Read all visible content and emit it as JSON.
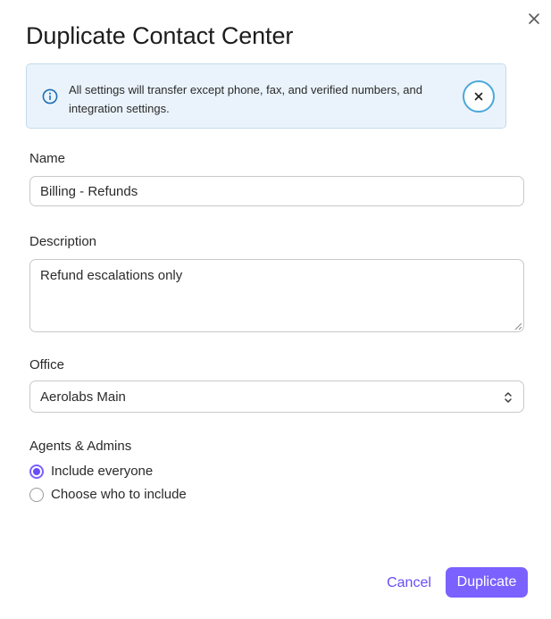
{
  "dialog": {
    "title": "Duplicate Contact Center",
    "close_icon": "close-icon"
  },
  "banner": {
    "icon": "info-icon",
    "text": "All settings will transfer except phone, fax, and verified numbers, and integration settings.",
    "dismiss_icon": "close-icon",
    "accent_color": "#4aa8da",
    "background_color": "#eaf3fb"
  },
  "form": {
    "name": {
      "label": "Name",
      "value": "Billing - Refunds"
    },
    "description": {
      "label": "Description",
      "value": "Refund escalations only"
    },
    "office": {
      "label": "Office",
      "selected": "Aerolabs Main",
      "icon": "chevron-up-down-icon"
    },
    "agents": {
      "label": "Agents & Admins",
      "options": [
        {
          "label": "Include everyone",
          "checked": true
        },
        {
          "label": "Choose who to include",
          "checked": false
        }
      ]
    }
  },
  "footer": {
    "cancel_label": "Cancel",
    "duplicate_label": "Duplicate",
    "primary_color": "#7b61ff"
  }
}
